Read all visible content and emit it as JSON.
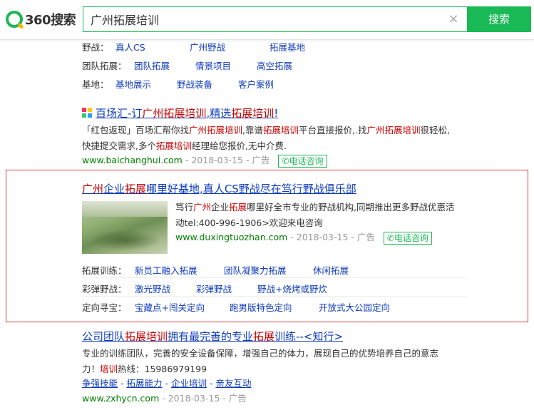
{
  "header": {
    "logo_text": "360搜索",
    "query": "广州拓展培训",
    "search_button": "搜索",
    "clear_glyph": "×"
  },
  "top_rows": [
    {
      "label": "野战：",
      "links": [
        "真人CS",
        "广州野战",
        "拓展基地"
      ]
    },
    {
      "label": "团队拓展：",
      "links": [
        "团队拓展",
        "情景项目",
        "高空拓展"
      ]
    },
    {
      "label": "基地：",
      "links": [
        "基地展示",
        "野战装备",
        "客户案例"
      ]
    }
  ],
  "result1": {
    "title_parts": [
      "百场汇-订",
      "广州拓展培训",
      ",精选",
      "拓展培训",
      "!"
    ],
    "desc_line1_parts": [
      "「红包返现」百场汇帮你找",
      "广州拓展培训",
      ",靠谱",
      "拓展培训",
      "平台直接报价,.找",
      "广州拓展培训",
      "很轻松,"
    ],
    "desc_line2_parts": [
      "快捷提交需求,多个",
      "拓展培训",
      "经理给您报价,无中介费."
    ],
    "url": "www.baichanghui.com",
    "date": " - 2018-03-15 - ",
    "ad": "广告",
    "phone": "电话咨询"
  },
  "result2": {
    "title_parts": [
      "广州",
      "企业",
      "拓展",
      "哪里好基地,真人CS野战尽在笃行野战俱乐部"
    ],
    "desc_line1_parts": [
      "笃行",
      "广州",
      "企业",
      "拓展",
      "哪里好全市专业的野战机构,同期推出更多野战优惠活"
    ],
    "desc_line2": "动tel:400-996-1906>欢迎来电咨询",
    "url": "www.duxingtuozhan.com",
    "date": " - 2018-03-15 - ",
    "ad": "广告",
    "phone": "电话咨询",
    "sub_rows": [
      {
        "label": "拓展训练：",
        "links": [
          "新员工融入拓展",
          "团队凝聚力拓展",
          "休闲拓展"
        ]
      },
      {
        "label": "彩弹野战：",
        "links": [
          "激光野战",
          "彩弹野战",
          "野战+烧烤或野炊"
        ]
      },
      {
        "label": "定向寻宝：",
        "links": [
          "宝藏点+闯关定向",
          "跑男版特色定向",
          "开放式大公园定向"
        ]
      }
    ]
  },
  "result3": {
    "title_parts": [
      "公司团队",
      "拓展培训",
      "拥有最完善的专业",
      "拓展",
      "训练--<知行>"
    ],
    "desc_line1": "专业的训练团队，完善的安全设备保障，增强自己的体力，展现自己的优势培养自己的意志",
    "desc_line2_parts": [
      "力！",
      "培训",
      "热线：15986979199"
    ],
    "links": [
      "争强技能",
      "拓展能力",
      "企业培训",
      "亲友互动"
    ],
    "url": "www.zxhycn.com",
    "date": " - 2018-03-15 - ",
    "ad": "广告"
  },
  "colors": {
    "brand_green": "#19b955",
    "link_blue": "#0e3bbd",
    "highlight_red": "#cc0000",
    "url_green": "#008000",
    "ad_border": "#e03b3b"
  }
}
